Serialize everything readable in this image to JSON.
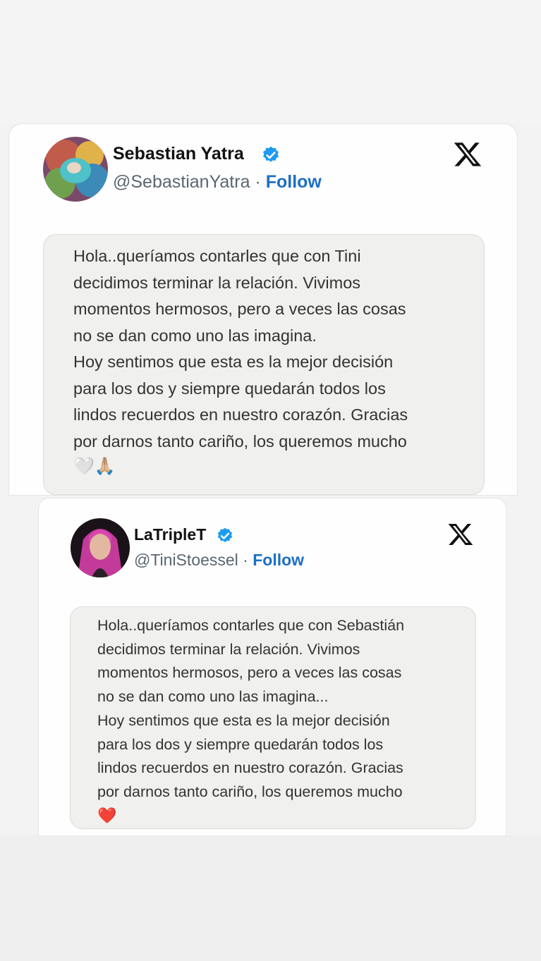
{
  "tweets": [
    {
      "author_name": "Sebastian Yatra",
      "handle": "@SebastianYatra",
      "separator": " · ",
      "follow_label": "Follow",
      "verified_icon": "verified-badge-icon",
      "platform_icon": "x-logo-icon",
      "message": "Hola..queríamos contarles que con Tini\ndecidimos terminar la relación. Vivimos\nmomentos hermosos, pero a veces las cosas\nno se dan como uno las imagina.\nHoy sentimos que esta es la mejor decisión\npara los dos y siempre quedarán todos los\nlindos recuerdos en nuestro corazón. Gracias\npor darnos tanto cariño, los queremos mucho",
      "emojis": "🤍🙏🏼"
    },
    {
      "author_name": "LaTripleT",
      "handle": "@TiniStoessel",
      "separator": " · ",
      "follow_label": "Follow",
      "verified_icon": "verified-badge-icon",
      "platform_icon": "x-logo-icon",
      "message": "Hola..queríamos contarles que con Sebastián\ndecidimos terminar la relación. Vivimos\nmomentos hermosos, pero a veces las cosas\nno se dan como uno las imagina...\nHoy sentimos que esta es la mejor decisión\npara los dos y siempre quedarán todos los\nlindos recuerdos en nuestro corazón. Gracias\npor darnos tanto cariño, los queremos mucho",
      "emojis": "❤️"
    }
  ],
  "colors": {
    "follow": "#1d6fc4",
    "verified": "#1d9bf0",
    "quote_background": "#f0f0ee"
  }
}
